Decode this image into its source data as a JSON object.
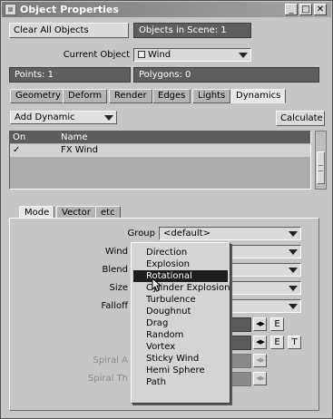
{
  "window": {
    "title": "Object Properties",
    "minimize_glyph": "_",
    "restore_glyph": "□",
    "close_glyph": "✕"
  },
  "top": {
    "clear_all_label": "Clear All Objects",
    "objects_in_scene": "Objects in Scene: 1",
    "current_object_label": "Current Object",
    "current_object_value": "Wind",
    "points": "Points: 1",
    "polygons": "Polygons: 0"
  },
  "tabs": [
    {
      "label": "Geometry",
      "active": false
    },
    {
      "label": "Deform",
      "active": false
    },
    {
      "label": "Render",
      "active": false
    },
    {
      "label": "Edges",
      "active": false
    },
    {
      "label": "Lights",
      "active": false
    },
    {
      "label": "Dynamics",
      "active": true
    }
  ],
  "dynamics": {
    "add_dynamic_label": "Add Dynamic",
    "calculate_label": "Calculate",
    "columns": [
      "On",
      "Name"
    ],
    "rows": [
      {
        "on": "✓",
        "name": "FX Wind"
      }
    ]
  },
  "subtabs": [
    {
      "label": "Mode",
      "active": true
    },
    {
      "label": "Vector",
      "active": false
    },
    {
      "label": "etc",
      "active": false
    }
  ],
  "mode_panel": {
    "group_label": "Group",
    "group_value": "<default>",
    "labels": [
      "Wind",
      "Blend",
      "Size",
      "Falloff"
    ],
    "disabled_labels": [
      "Spiral A",
      "Spiral Th"
    ],
    "e_label": "E",
    "t_label": "T",
    "envelope_glyph": "◀▶"
  },
  "dropdown_menu": {
    "items": [
      "Direction",
      "Explosion",
      "Rotational",
      "Cylinder Explosion",
      "Turbulence",
      "Doughnut",
      "Drag",
      "Random",
      "Vortex",
      "Sticky Wind",
      "Hemi Sphere",
      "Path"
    ],
    "highlighted_index": 2
  }
}
